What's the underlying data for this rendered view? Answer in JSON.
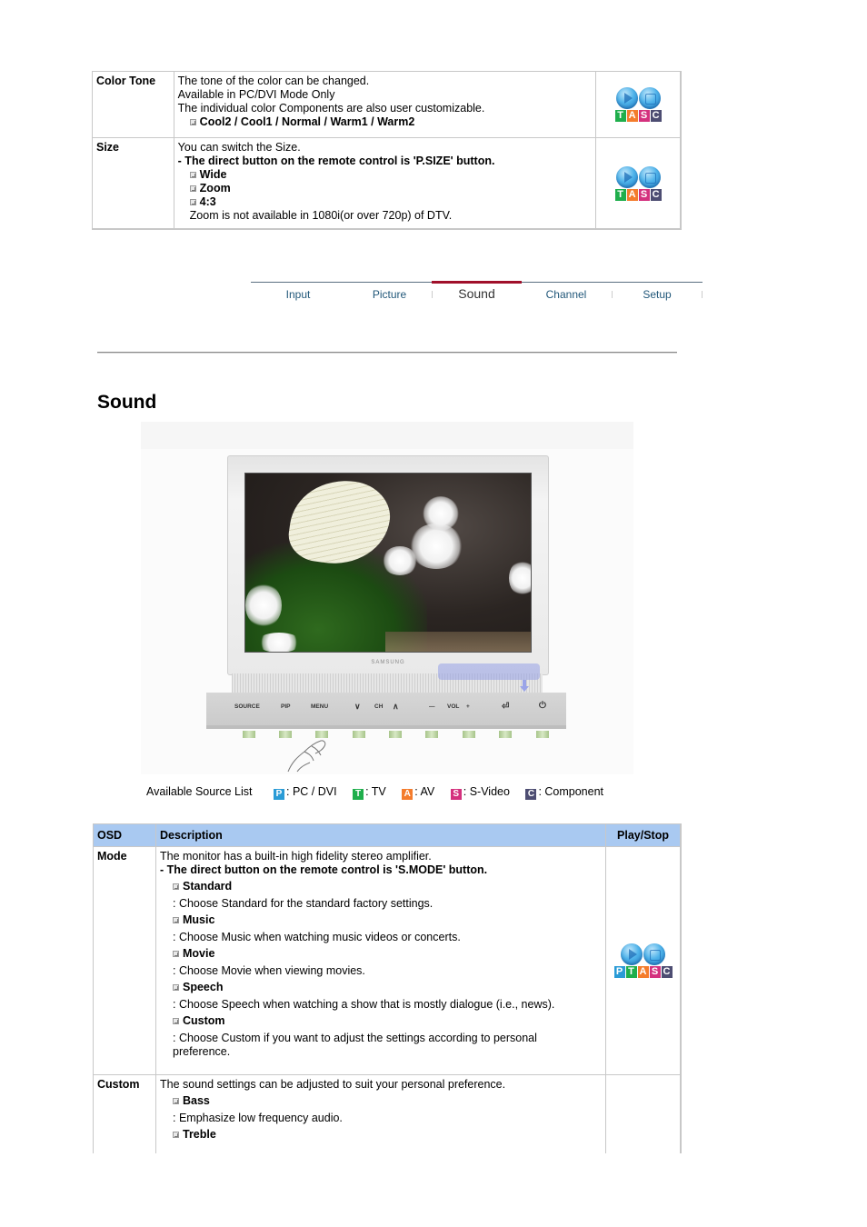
{
  "top_table": {
    "rows": [
      {
        "osd": "Color Tone",
        "lines": [
          "The tone of the color can be changed.",
          "Available in PC/DVI Mode Only",
          "The individual color Components are also user customizable."
        ],
        "options": [
          "Cool2 / Cool1 / Normal / Warm1 / Warm2"
        ],
        "icon": {
          "name": "play-stop-icon",
          "letters": [
            "T",
            "A",
            "S",
            "C"
          ]
        }
      },
      {
        "osd": "Size",
        "lines": [
          "You can switch the Size."
        ],
        "bold_line": "- The direct button on the remote control is 'P.SIZE' button.",
        "options": [
          "Wide",
          "Zoom",
          "4:3"
        ],
        "note": "Zoom is not available in 1080i(or over 720p) of DTV.",
        "icon": {
          "name": "play-stop-icon",
          "letters": [
            "T",
            "A",
            "S",
            "C"
          ]
        }
      }
    ]
  },
  "tabs": [
    {
      "label": "Input",
      "active": false
    },
    {
      "label": "Picture",
      "active": false
    },
    {
      "label": "Sound",
      "active": true
    },
    {
      "label": "Channel",
      "active": false
    },
    {
      "label": "Setup",
      "active": false
    }
  ],
  "section_title": "Sound",
  "illustration": {
    "brand": "SAMSUNG",
    "panel_buttons": [
      "SOURCE",
      "PIP",
      "MENU",
      "∨",
      "CH",
      "∧",
      "—",
      "VOL",
      "+",
      "⏎",
      "⏻"
    ]
  },
  "source_list": {
    "label": "Available Source List",
    "items": [
      {
        "letter": "P",
        "text": ": PC / DVI",
        "color": "#2a9bd6"
      },
      {
        "letter": "T",
        "text": ": TV",
        "color": "#1fae4c"
      },
      {
        "letter": "A",
        "text": ": AV",
        "color": "#f47c2c"
      },
      {
        "letter": "S",
        "text": ": S-Video",
        "color": "#d4317e"
      },
      {
        "letter": "C",
        "text": ": Component",
        "color": "#4d4d72"
      }
    ]
  },
  "bottom_table": {
    "headers": {
      "osd": "OSD",
      "description": "Description",
      "play_stop": "Play/Stop"
    },
    "header_color": "#a9c9f1",
    "rows": [
      {
        "osd": "Mode",
        "intro": "The monitor has a built-in high fidelity stereo amplifier.",
        "bold_line": "- The direct button on the remote control is 'S.MODE' button.",
        "options": [
          {
            "title": "Standard",
            "desc": ": Choose Standard for the standard factory settings."
          },
          {
            "title": "Music",
            "desc": ": Choose Music when watching music videos or concerts."
          },
          {
            "title": "Movie",
            "desc": ": Choose Movie when viewing movies."
          },
          {
            "title": "Speech",
            "desc": ": Choose Speech when watching a show that is mostly dialogue (i.e., news)."
          },
          {
            "title": "Custom",
            "desc": ": Choose Custom if you want to adjust the settings according to personal preference."
          }
        ],
        "icon": {
          "name": "play-stop-icon",
          "letters": [
            "P",
            "T",
            "A",
            "S",
            "C"
          ]
        }
      },
      {
        "osd": "Custom",
        "intro": "The sound settings can be adjusted to suit your personal preference.",
        "options": [
          {
            "title": "Bass",
            "desc": ": Emphasize low frequency audio."
          },
          {
            "title": "Treble",
            "desc": ""
          }
        ]
      }
    ]
  }
}
